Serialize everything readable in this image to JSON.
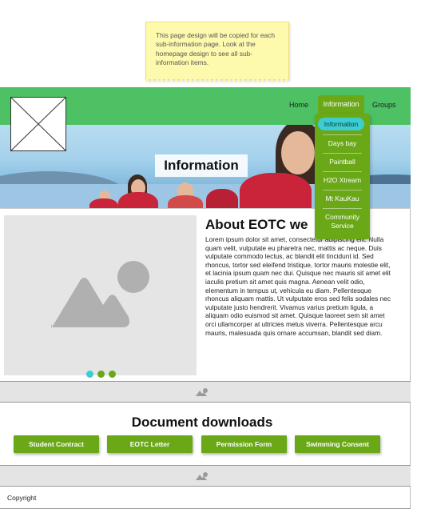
{
  "sticky_note": {
    "text": "This page design will be copied for each sub-information page. Look at the homepage design to see all sub-information items."
  },
  "nav": {
    "home": "Home",
    "information": "Information",
    "groups": "Groups"
  },
  "dropdown": {
    "items": [
      "Information",
      "Days bay",
      "Paintball",
      "H2O Xtream",
      "Mt KauKau",
      "Community Service"
    ],
    "active_index": 0
  },
  "hero": {
    "title": "Information"
  },
  "about": {
    "title": "About EOTC we",
    "body": "Lorem ipsum dolor sit amet, consectetur adipiscing elit. Nulla quam velit, vulputate eu pharetra nec, mattis ac neque. Duis vulputate commodo lectus, ac blandit elit tincidunt id. Sed rhoncus, tortor sed eleifend tristique, tortor mauris molestie elit, et lacinia ipsum quam nec dui. Quisque nec mauris sit amet elit iaculis pretium sit amet quis magna. Aenean velit odio, elementum in tempus ut, vehicula eu diam. Pellentesque rhoncus aliquam mattis. Ut vulputate eros sed felis sodales nec vulputate justo hendrerit. Vivamus varius pretium ligula, a aliquam odio euismod sit amet. Quisque laoreet sem sit amet orci ullamcorper at ultricies metus viverra. Pellentesque arcu mauris, malesuada quis ornare accumsan, blandit sed diam.",
    "carousel_dots": [
      "#3ccdd0",
      "#6aa818",
      "#6aa818"
    ]
  },
  "downloads": {
    "title": "Document downloads",
    "buttons": [
      "Student Contract",
      "EOTC Letter",
      "Permission Form",
      "Swimming Consent"
    ]
  },
  "footer": {
    "copyright": "Copyright"
  },
  "colors": {
    "nav_green": "#4dc164",
    "button_green": "#6aa818",
    "active_cyan": "#3ccdd0",
    "sticky_yellow": "#fdfaae"
  }
}
